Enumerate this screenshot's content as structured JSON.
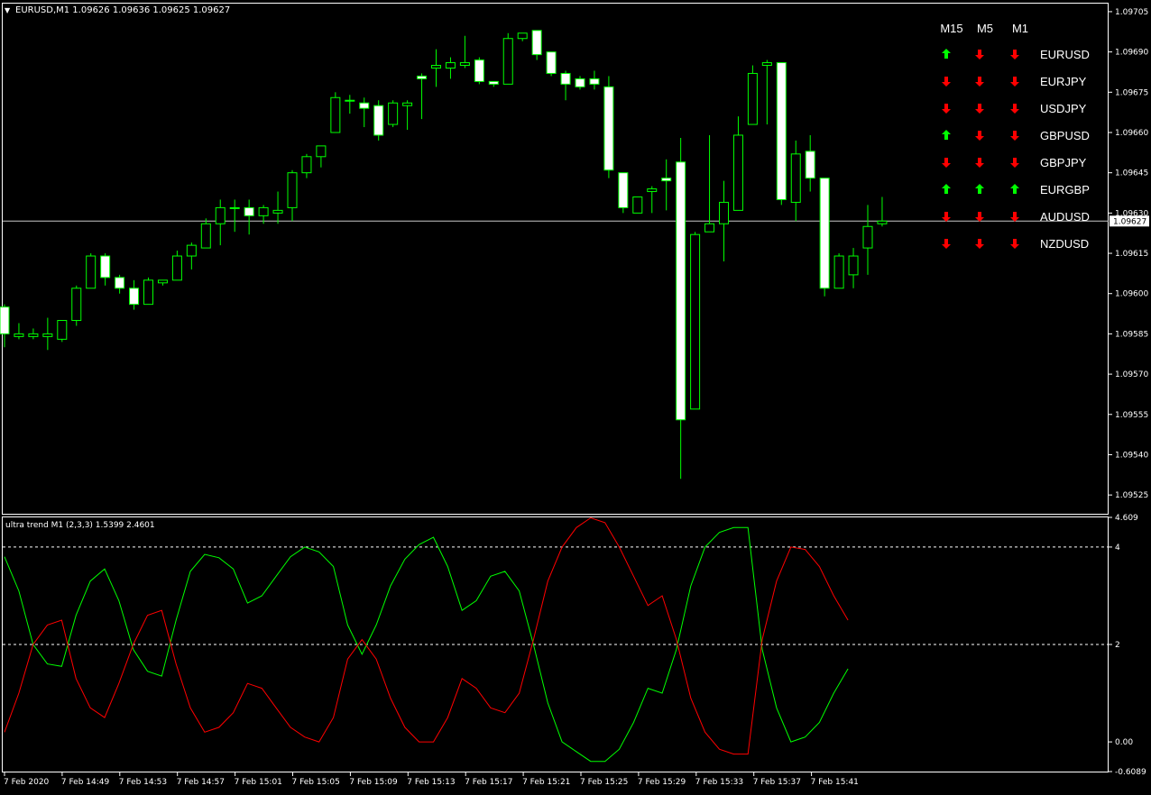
{
  "window": {
    "title": "EURUSD,M1  1.09626 1.09636 1.09625 1.09627",
    "menu_glyph": "▼"
  },
  "indicator": {
    "title": "ultra trend M1 (2,3,3) 1.5399 2.4601"
  },
  "colors": {
    "background": "#000000",
    "bull": "#00ff00",
    "bear_fill": "#ffffff",
    "green_line": "#00ff00",
    "red_line": "#ff0000",
    "grid_text": "#ffffff",
    "up_arrow": "#00ff00",
    "down_arrow": "#ff0000"
  },
  "trend_panel": {
    "headers": [
      "M15",
      "M5",
      "M1"
    ],
    "rows": [
      {
        "symbol": "EURUSD",
        "dirs": [
          "up",
          "down",
          "down"
        ]
      },
      {
        "symbol": "EURJPY",
        "dirs": [
          "down",
          "down",
          "down"
        ]
      },
      {
        "symbol": "USDJPY",
        "dirs": [
          "down",
          "down",
          "down"
        ]
      },
      {
        "symbol": "GBPUSD",
        "dirs": [
          "up",
          "down",
          "down"
        ]
      },
      {
        "symbol": "GBPJPY",
        "dirs": [
          "down",
          "down",
          "down"
        ]
      },
      {
        "symbol": "EURGBP",
        "dirs": [
          "up",
          "up",
          "up"
        ]
      },
      {
        "symbol": "AUDUSD",
        "dirs": [
          "down",
          "down",
          "down"
        ]
      },
      {
        "symbol": "NZDUSD",
        "dirs": [
          "down",
          "down",
          "down"
        ]
      }
    ]
  },
  "chart_data": [
    {
      "type": "candlestick",
      "symbol": "EURUSD",
      "timeframe": "M1",
      "ylim": [
        1.09518,
        1.09708
      ],
      "y_ticks": [
        "1.09705",
        "1.09690",
        "1.09675",
        "1.09660",
        "1.09645",
        "1.09630",
        "1.09615",
        "1.09600",
        "1.09585",
        "1.09570",
        "1.09555",
        "1.09540",
        "1.09525"
      ],
      "current_price": "1.09627",
      "candles": [
        [
          1.09595,
          1.09596,
          1.0958,
          1.09585
        ],
        [
          1.09584,
          1.09589,
          1.09583,
          1.09585
        ],
        [
          1.09584,
          1.09587,
          1.09583,
          1.09585
        ],
        [
          1.09584,
          1.09591,
          1.09579,
          1.09585
        ],
        [
          1.09583,
          1.0959,
          1.09582,
          1.0959
        ],
        [
          1.0959,
          1.09603,
          1.09588,
          1.09602
        ],
        [
          1.09602,
          1.09615,
          1.09602,
          1.09614
        ],
        [
          1.09614,
          1.09615,
          1.09603,
          1.09606
        ],
        [
          1.09606,
          1.09607,
          1.096,
          1.09602
        ],
        [
          1.09602,
          1.09605,
          1.09594,
          1.09596
        ],
        [
          1.09596,
          1.09606,
          1.09597,
          1.09605
        ],
        [
          1.09604,
          1.09605,
          1.09603,
          1.09605
        ],
        [
          1.09605,
          1.09616,
          1.09605,
          1.09614
        ],
        [
          1.09614,
          1.09619,
          1.09609,
          1.09618
        ],
        [
          1.09617,
          1.09628,
          1.09617,
          1.09626
        ],
        [
          1.09626,
          1.09635,
          1.09618,
          1.09632
        ],
        [
          1.09632,
          1.09635,
          1.09623,
          1.09632
        ],
        [
          1.09632,
          1.09635,
          1.09622,
          1.09629
        ],
        [
          1.09629,
          1.09633,
          1.09626,
          1.09632
        ],
        [
          1.0963,
          1.09638,
          1.09626,
          1.09631
        ],
        [
          1.09632,
          1.09646,
          1.09627,
          1.09645
        ],
        [
          1.09645,
          1.09652,
          1.09643,
          1.09651
        ],
        [
          1.09651,
          1.09653,
          1.09647,
          1.09655
        ],
        [
          1.0966,
          1.09675,
          1.0966,
          1.09673
        ],
        [
          1.09672,
          1.09674,
          1.09667,
          1.09672
        ],
        [
          1.09671,
          1.09673,
          1.09662,
          1.09669
        ],
        [
          1.0967,
          1.09672,
          1.09657,
          1.09659
        ],
        [
          1.09663,
          1.09672,
          1.09662,
          1.09671
        ],
        [
          1.0967,
          1.09672,
          1.09661,
          1.09671
        ],
        [
          1.09681,
          1.09682,
          1.09665,
          1.0968
        ],
        [
          1.09684,
          1.09691,
          1.09677,
          1.09685
        ],
        [
          1.09684,
          1.09688,
          1.0968,
          1.09686
        ],
        [
          1.09685,
          1.09696,
          1.09684,
          1.09686
        ],
        [
          1.09687,
          1.09688,
          1.09678,
          1.09679
        ],
        [
          1.09679,
          1.09679,
          1.09677,
          1.09678
        ],
        [
          1.09678,
          1.09697,
          1.09678,
          1.09695
        ],
        [
          1.09695,
          1.09697,
          1.09694,
          1.09697
        ],
        [
          1.09698,
          1.09698,
          1.09687,
          1.09689
        ],
        [
          1.0969,
          1.0969,
          1.09681,
          1.09682
        ],
        [
          1.09682,
          1.09683,
          1.09672,
          1.09678
        ],
        [
          1.0968,
          1.09681,
          1.09676,
          1.09677
        ],
        [
          1.0968,
          1.09683,
          1.09676,
          1.09678
        ],
        [
          1.09677,
          1.09681,
          1.09643,
          1.09646
        ],
        [
          1.09645,
          1.09645,
          1.0963,
          1.09632
        ],
        [
          1.0963,
          1.09634,
          1.0963,
          1.09636
        ],
        [
          1.09638,
          1.0964,
          1.0963,
          1.09639
        ],
        [
          1.09643,
          1.0965,
          1.09631,
          1.09642
        ],
        [
          1.09649,
          1.09658,
          1.09531,
          1.09553
        ],
        [
          1.09557,
          1.09623,
          1.09557,
          1.09622
        ],
        [
          1.09623,
          1.09659,
          1.09624,
          1.09626
        ],
        [
          1.09626,
          1.09642,
          1.09612,
          1.09634
        ],
        [
          1.09631,
          1.09666,
          1.09631,
          1.09659
        ],
        [
          1.09663,
          1.09685,
          1.09663,
          1.09682
        ],
        [
          1.09685,
          1.09687,
          1.09663,
          1.09686
        ],
        [
          1.09686,
          1.09686,
          1.09633,
          1.09635
        ],
        [
          1.09634,
          1.09657,
          1.09627,
          1.09652
        ],
        [
          1.09653,
          1.09659,
          1.09638,
          1.09643
        ],
        [
          1.09643,
          1.09643,
          1.09599,
          1.09602
        ],
        [
          1.09602,
          1.09615,
          1.09602,
          1.09614
        ],
        [
          1.09607,
          1.09617,
          1.09602,
          1.09614
        ],
        [
          1.09617,
          1.09633,
          1.09607,
          1.09625
        ],
        [
          1.09626,
          1.09636,
          1.09625,
          1.09627
        ]
      ]
    },
    {
      "type": "line",
      "name": "ultra trend M1 (2,3,3)",
      "ylim": [
        -0.6089,
        4.609
      ],
      "y_ticks": [
        "4.609",
        "4",
        "2",
        "0.00",
        "-0.6089"
      ],
      "levels": [
        4,
        2
      ],
      "series": [
        {
          "color": "green",
          "values": [
            3.8,
            3.1,
            2.0,
            1.6,
            1.55,
            2.6,
            3.3,
            3.55,
            2.9,
            1.9,
            1.45,
            1.35,
            2.5,
            3.5,
            3.85,
            3.78,
            3.55,
            2.85,
            3.0,
            3.4,
            3.8,
            4.0,
            3.9,
            3.6,
            2.4,
            1.8,
            2.4,
            3.2,
            3.75,
            4.05,
            4.2,
            3.6,
            2.7,
            2.9,
            3.4,
            3.5,
            3.1,
            2.0,
            0.8,
            0.0,
            -0.2,
            -0.4,
            -0.4,
            -0.15,
            0.4,
            1.1,
            1.0,
            1.9,
            3.2,
            4.0,
            4.3,
            4.4,
            4.4,
            1.9,
            0.7,
            0.0,
            0.1,
            0.4,
            1.0,
            1.5
          ]
        },
        {
          "color": "red",
          "values": [
            0.2,
            1.0,
            2.0,
            2.4,
            2.5,
            1.3,
            0.7,
            0.5,
            1.2,
            2.0,
            2.6,
            2.7,
            1.6,
            0.7,
            0.2,
            0.3,
            0.6,
            1.2,
            1.1,
            0.7,
            0.3,
            0.1,
            0.0,
            0.5,
            1.7,
            2.1,
            1.7,
            0.9,
            0.3,
            0.0,
            0.0,
            0.5,
            1.3,
            1.1,
            0.7,
            0.6,
            1.0,
            2.1,
            3.3,
            4.0,
            4.4,
            4.6,
            4.5,
            4.0,
            3.4,
            2.8,
            3.0,
            2.1,
            0.9,
            0.2,
            -0.15,
            -0.25,
            -0.25,
            2.1,
            3.3,
            4.0,
            3.95,
            3.6,
            3.0,
            2.5
          ]
        }
      ]
    }
  ],
  "time_axis": {
    "labels": [
      "7 Feb 2020",
      "7 Feb 14:49",
      "7 Feb 14:53",
      "7 Feb 14:57",
      "7 Feb 15:01",
      "7 Feb 15:05",
      "7 Feb 15:09",
      "7 Feb 15:13",
      "7 Feb 15:17",
      "7 Feb 15:21",
      "7 Feb 15:25",
      "7 Feb 15:29",
      "7 Feb 15:33",
      "7 Feb 15:37",
      "7 Feb 15:41"
    ]
  }
}
